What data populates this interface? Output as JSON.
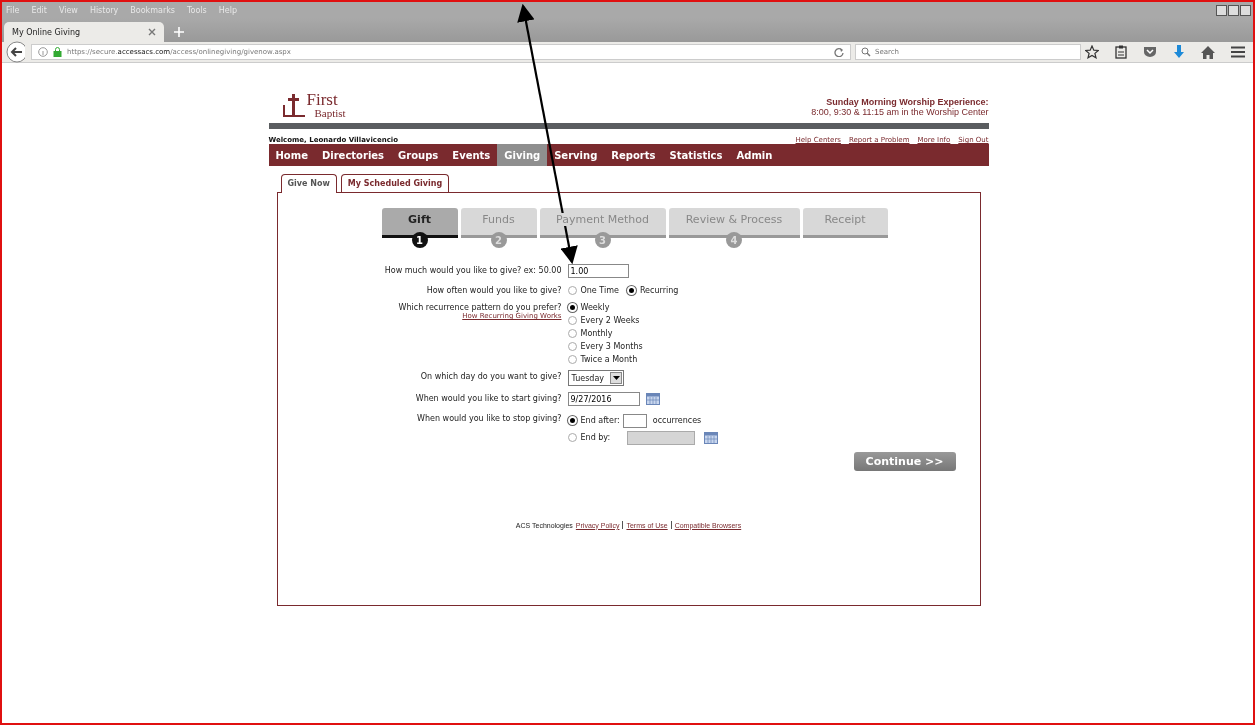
{
  "browser": {
    "menu": [
      "File",
      "Edit",
      "View",
      "History",
      "Bookmarks",
      "Tools",
      "Help"
    ],
    "tab": {
      "title": "My Online Giving"
    },
    "url": {
      "prefix": "https://secure.",
      "domain": "accessacs.com",
      "path": "/access/onlinegiving/givenow.aspx"
    },
    "search": {
      "placeholder": "Search"
    }
  },
  "site": {
    "logo": {
      "line1": "First",
      "line2": "Baptist"
    },
    "service": {
      "title": "Sunday Morning Worship Experience:",
      "times": "8:00, 9:30 & 11:15 am in the Worship Center"
    },
    "welcome": "Welcome, Leonardo Villavicencio",
    "header_links": [
      "Help Centers",
      "Report a Problem",
      "More Info",
      "Sign Out"
    ],
    "nav": [
      {
        "label": "Home",
        "selected": false
      },
      {
        "label": "Directories",
        "selected": false
      },
      {
        "label": "Groups",
        "selected": false
      },
      {
        "label": "Events",
        "selected": false
      },
      {
        "label": "Giving",
        "selected": true
      },
      {
        "label": "Serving",
        "selected": false
      },
      {
        "label": "Reports",
        "selected": false
      },
      {
        "label": "Statistics",
        "selected": false
      },
      {
        "label": "Admin",
        "selected": false
      }
    ],
    "subtabs": [
      {
        "label": "Give Now",
        "selected": true
      },
      {
        "label": "My Scheduled Giving",
        "selected": false
      }
    ],
    "steps": [
      {
        "label": "Gift",
        "number": "1",
        "selected": true
      },
      {
        "label": "Funds",
        "number": "2",
        "selected": false
      },
      {
        "label": "Payment Method",
        "number": "3",
        "selected": false
      },
      {
        "label": "Review & Process",
        "number": "4",
        "selected": false
      },
      {
        "label": "Receipt",
        "selected": false
      }
    ],
    "form": [
      {
        "kind": "text",
        "label": "How much would you like to give? ex: 50.00",
        "value": "1.00"
      },
      {
        "kind": "radio-inline",
        "label": "How often would you like to give?",
        "options": [
          {
            "label": "One Time",
            "selected": false
          },
          {
            "label": "Recurring",
            "selected": true
          }
        ]
      },
      {
        "kind": "radio-list",
        "label": "Which recurrence pattern do you prefer?",
        "link": "How Recurring Giving Works",
        "options": [
          {
            "label": "Weekly",
            "selected": true
          },
          {
            "label": "Every 2 Weeks",
            "selected": false
          },
          {
            "label": "Monthly",
            "selected": false
          },
          {
            "label": "Every 3 Months",
            "selected": false
          },
          {
            "label": "Twice a Month",
            "selected": false
          }
        ]
      },
      {
        "kind": "select",
        "label": "On which day do you want to give?",
        "value": "Tuesday"
      },
      {
        "kind": "date",
        "label": "When would you like to start giving?",
        "value": "9/27/2016"
      },
      {
        "kind": "stop",
        "label": "When would you like to stop giving?",
        "after": {
          "label": "End after:",
          "suffix": "occurrences",
          "selected": true
        },
        "by": {
          "label": "End by:",
          "selected": false
        }
      }
    ],
    "continue": "Continue >>",
    "footer": {
      "text": "ACS Technologies",
      "links": [
        "Privacy Policy",
        "Terms of Use",
        "Compatible Browsers"
      ]
    }
  }
}
